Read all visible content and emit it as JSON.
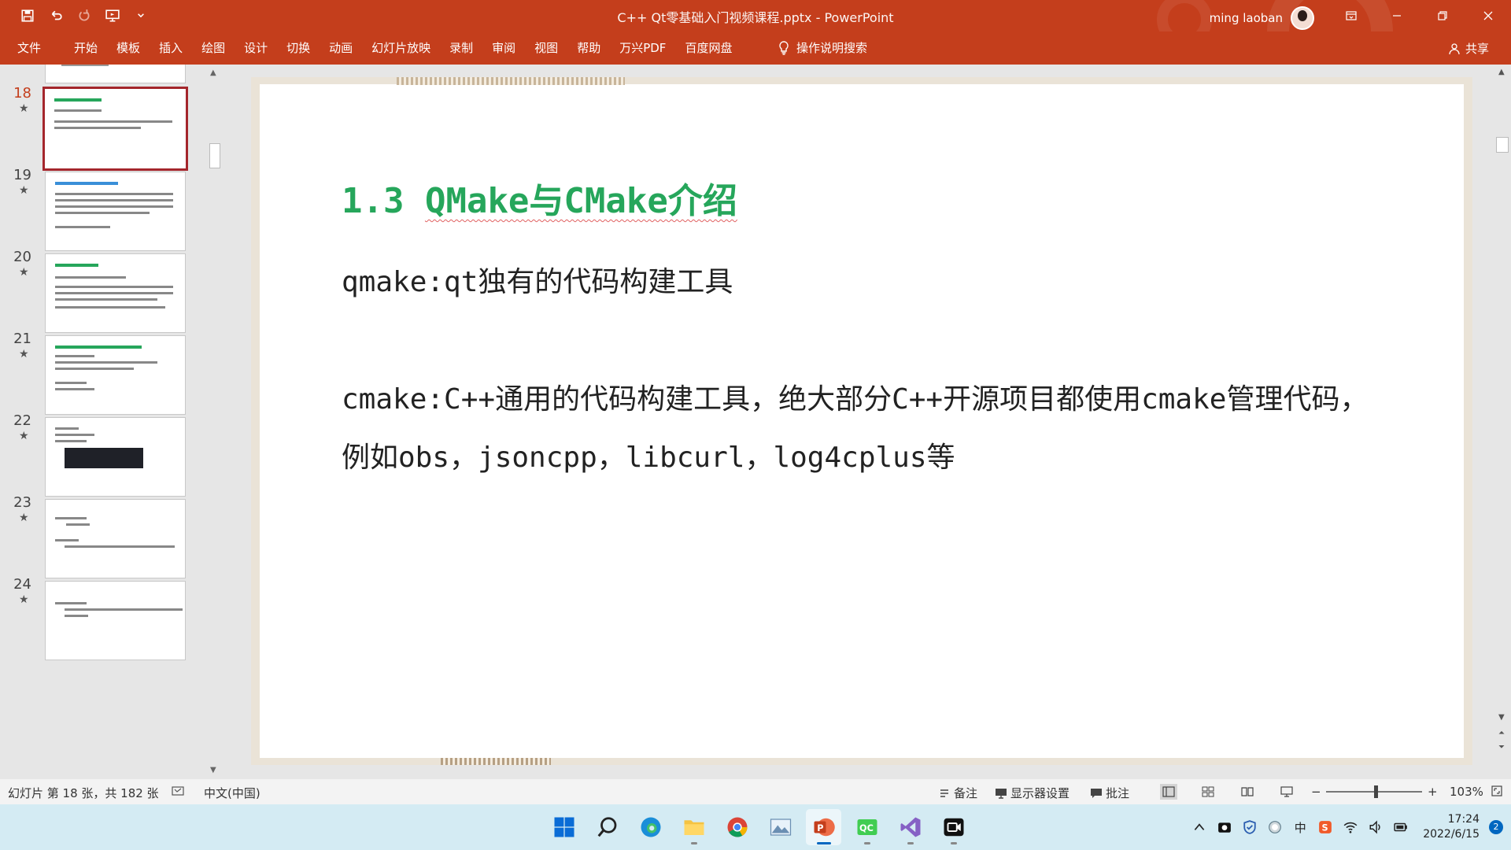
{
  "window": {
    "title": "C++ Qt零基础入门视频课程.pptx  -  PowerPoint",
    "user_name": "ming laoban"
  },
  "ribbon": {
    "tabs": [
      "文件",
      "开始",
      "模板",
      "插入",
      "绘图",
      "设计",
      "切换",
      "动画",
      "幻灯片放映",
      "录制",
      "审阅",
      "视图",
      "帮助",
      "万兴PDF",
      "百度网盘"
    ],
    "tell_me": "操作说明搜索",
    "share": "共享"
  },
  "thumbnails": {
    "slides": [
      {
        "num": "18",
        "mark": "★",
        "active": true
      },
      {
        "num": "19",
        "mark": "★",
        "active": false
      },
      {
        "num": "20",
        "mark": "★",
        "active": false
      },
      {
        "num": "21",
        "mark": "★",
        "active": false
      },
      {
        "num": "22",
        "mark": "★",
        "active": false
      },
      {
        "num": "23",
        "mark": "★",
        "active": false
      },
      {
        "num": "24",
        "mark": "★",
        "active": false
      }
    ]
  },
  "slide": {
    "title_prefix": "1.3 ",
    "title_main": "QMake与CMake介绍",
    "para1": "qmake:qt独有的代码构建工具",
    "para2": "cmake:C++通用的代码构建工具，绝大部分C++开源项目都使用cmake管理代码，例如obs，jsoncpp，libcurl，log4cplus等"
  },
  "status": {
    "slide_info": "幻灯片 第 18 张，共 182 张",
    "language": "中文(中国)",
    "notes": "备注",
    "display_settings": "显示器设置",
    "comments": "批注",
    "zoom_minus": "−",
    "zoom_plus": "+",
    "zoom_level": "103%"
  },
  "taskbar": {
    "time": "17:24",
    "date": "2022/6/15",
    "notifications": "2",
    "ime": "中"
  },
  "colors": {
    "accent": "#c43e1c",
    "title_green": "#26a65b",
    "taskbar": "#d4ebf3"
  }
}
